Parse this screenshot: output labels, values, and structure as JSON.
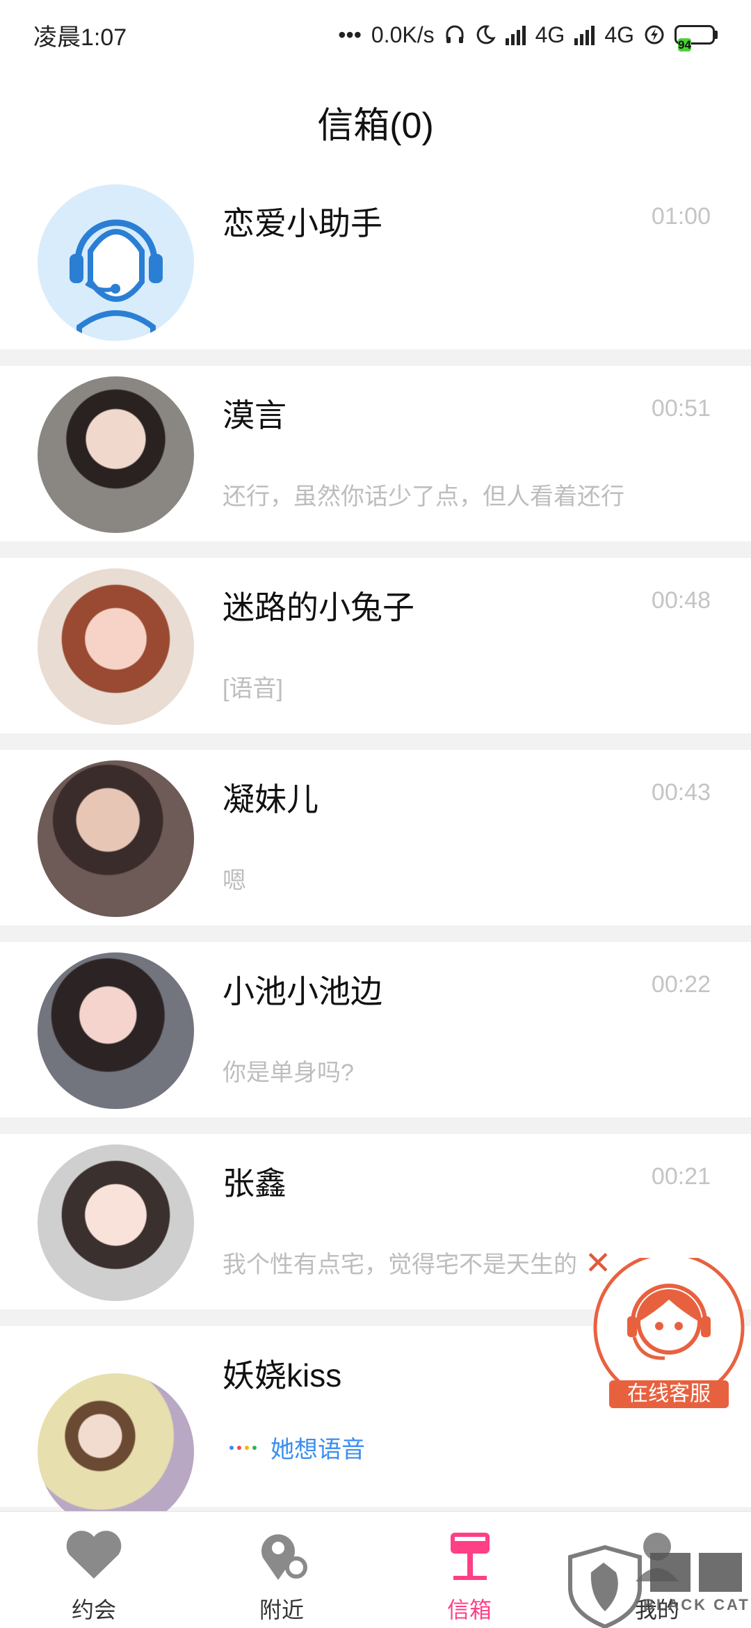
{
  "status_bar": {
    "time": "凌晨1:07",
    "net_speed": "0.0K/s",
    "net1": "4G",
    "net2": "4G",
    "battery": "94"
  },
  "header": {
    "title": "信箱(0)"
  },
  "messages": [
    {
      "name": "恋爱小助手",
      "time": "01:00",
      "preview": ""
    },
    {
      "name": "漠言",
      "time": "00:51",
      "preview": "还行，虽然你话少了点，但人看着还行"
    },
    {
      "name": "迷路的小兔子",
      "time": "00:48",
      "preview": "[语音]"
    },
    {
      "name": "凝妹儿",
      "time": "00:43",
      "preview": "嗯"
    },
    {
      "name": "小池小池边",
      "time": "00:22",
      "preview": "你是单身吗?"
    },
    {
      "name": "张鑫",
      "time": "00:21",
      "preview": "我个性有点宅，觉得宅不是天生的"
    },
    {
      "name": "妖娆kiss",
      "time": "",
      "voice_prompt": "她想语音"
    }
  ],
  "fab": {
    "label": "在线客服",
    "close": "✕"
  },
  "bottom_nav": [
    {
      "label": "约会",
      "icon": "heart-icon"
    },
    {
      "label": "附近",
      "icon": "location-icon"
    },
    {
      "label": "信箱",
      "icon": "mailbox-icon",
      "active": true
    },
    {
      "label": "我的",
      "icon": "profile-icon"
    }
  ],
  "watermark": {
    "text": "BLACK CAT"
  },
  "colors": {
    "accent": "#ff3f86",
    "time": "#c4c4c4",
    "link": "#3a8ef0",
    "service": "#e8613f"
  }
}
